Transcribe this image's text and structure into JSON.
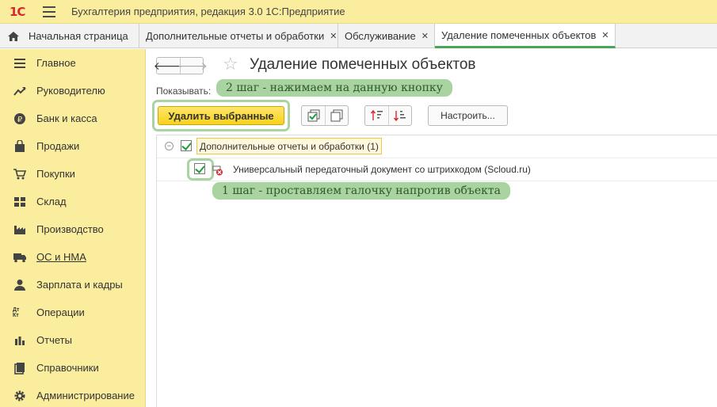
{
  "app": {
    "logo": "1С",
    "title": "Бухгалтерия предприятия, редакция 3.0 1С:Предприятие"
  },
  "tabs": [
    {
      "label": "Начальная страница"
    },
    {
      "label": "Дополнительные отчеты и обработки"
    },
    {
      "label": "Обслуживание"
    },
    {
      "label": "Удаление помеченных объектов"
    }
  ],
  "sidebar": {
    "items": [
      {
        "label": "Главное",
        "icon": "list-icon"
      },
      {
        "label": "Руководителю",
        "icon": "trend-icon"
      },
      {
        "label": "Банк и касса",
        "icon": "ruble-icon"
      },
      {
        "label": "Продажи",
        "icon": "bag-icon"
      },
      {
        "label": "Покупки",
        "icon": "cart-icon"
      },
      {
        "label": "Склад",
        "icon": "warehouse-icon"
      },
      {
        "label": "Производство",
        "icon": "factory-icon"
      },
      {
        "label": "ОС и НМА",
        "icon": "truck-icon"
      },
      {
        "label": "Зарплата и кадры",
        "icon": "person-icon"
      },
      {
        "label": "Операции",
        "icon": "dt-kt-icon",
        "icon_text": "Дт Кт"
      },
      {
        "label": "Отчеты",
        "icon": "bar-chart-icon"
      },
      {
        "label": "Справочники",
        "icon": "book-icon"
      },
      {
        "label": "Администрирование",
        "icon": "gear-icon"
      }
    ]
  },
  "main": {
    "title": "Удаление помеченных объектов",
    "show_label": "Показывать:",
    "delete_button": "Удалить выбранные",
    "settings_button": "Настроить...",
    "note_step2": "2 шаг - нажимаем на данную кнопку",
    "note_step1": "1 шаг - проставляем галочку напротив объекта",
    "tree": {
      "group": {
        "label": "Дополнительные отчеты и обработки (1)",
        "checked": true
      },
      "items": [
        {
          "label": "Универсальный передаточный документ со штрихкодом (Scloud.ru)",
          "checked": true
        }
      ]
    }
  },
  "colors": {
    "sidebar_bg": "#fbed9e",
    "accent_green": "#4aa657",
    "delete_button": "#f7d21b",
    "annotation": "#a9d3a0"
  }
}
